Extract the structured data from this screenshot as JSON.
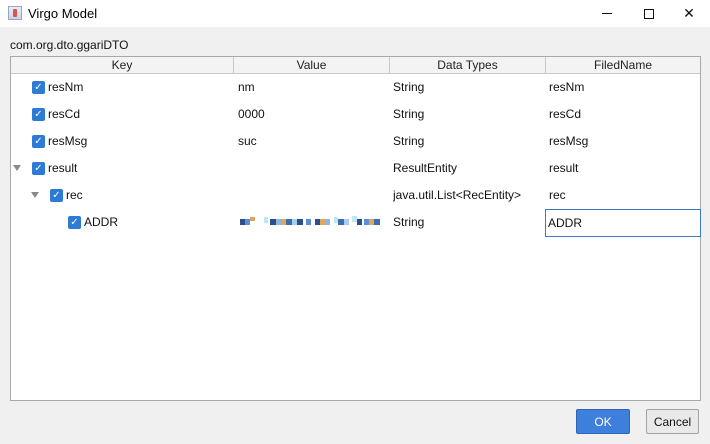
{
  "window": {
    "title": "Virgo Model",
    "icon": "app-icon",
    "controls": {
      "minimize": "minimize-icon",
      "maximize": "maximize-icon",
      "close_glyph": "✕"
    }
  },
  "class_name": "com.org.dto.ggariDTO",
  "table": {
    "columns": [
      "Key",
      "Value",
      "Data Types",
      "FiledName"
    ],
    "rows": [
      {
        "key": "resNm",
        "checked": true,
        "value": "nm",
        "type": "String",
        "filed": "resNm"
      },
      {
        "key": "resCd",
        "checked": true,
        "value": "0000",
        "type": "String",
        "filed": "resCd"
      },
      {
        "key": "resMsg",
        "checked": true,
        "value": "suc",
        "type": "String",
        "filed": "resMsg"
      },
      {
        "key": "result",
        "checked": true,
        "expanded": true,
        "value": "",
        "type": "ResultEntity",
        "filed": "result"
      },
      {
        "key": "rec",
        "checked": true,
        "expanded": true,
        "value": "",
        "type": "java.util.List<RecEntity>",
        "filed": "rec"
      },
      {
        "key": "ADDR",
        "checked": true,
        "value_masked": true,
        "type": "String",
        "filed": "ADDR",
        "filed_editing": true
      }
    ]
  },
  "check_glyph": "✓",
  "buttons": {
    "ok": "OK",
    "cancel": "Cancel"
  },
  "colors": {
    "accent": "#3d7fdb",
    "checkbox": "#2e7bd6",
    "edit_border": "#3c78c8"
  }
}
